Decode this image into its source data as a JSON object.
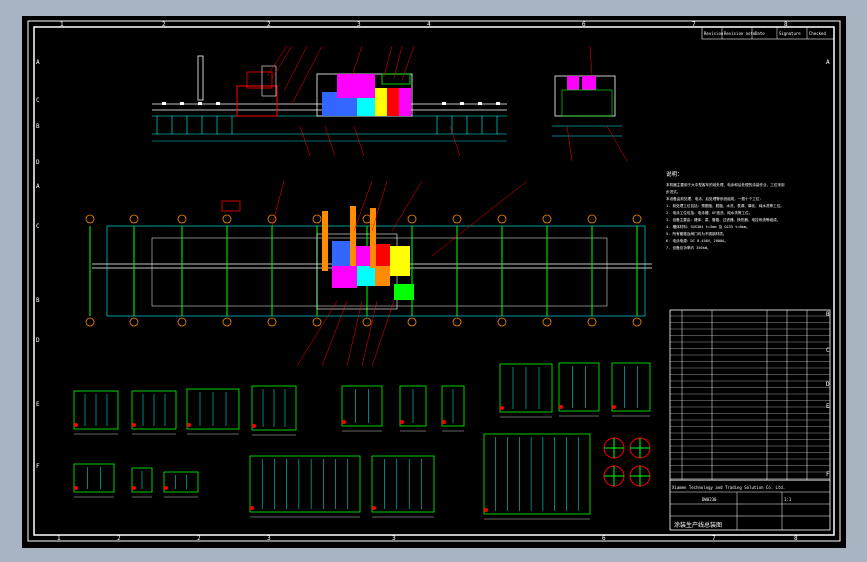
{
  "colors": {
    "background": "#a9b4c2",
    "sheet": "#000000",
    "frame": "#ffffff",
    "cyan": "#00ffff",
    "green": "#00ff00",
    "yellow": "#ffff00",
    "red": "#ff0000",
    "magenta": "#ff00ff",
    "orange": "#ff8c00",
    "blue": "#3366ff"
  },
  "top_border_numbers": [
    "1",
    "2",
    "3",
    "4",
    "5",
    "6",
    "7",
    "8"
  ],
  "bottom_border_numbers": [
    "1",
    "2",
    "3",
    "4",
    "5",
    "6",
    "7",
    "8"
  ],
  "left_border_letters": [
    "A",
    "C",
    "B",
    "D",
    "A",
    "C",
    "B",
    "D",
    "E",
    "F"
  ],
  "right_border_letters": [
    "A",
    "B",
    "C",
    "D",
    "B",
    "C",
    "D",
    "E",
    "F"
  ],
  "revision_table_headers": [
    "Revision",
    "Revision note",
    "Date",
    "Signature",
    "Checked"
  ],
  "notes": {
    "title": "说明：",
    "lines": [
      "本机器主要用于大中型客车的前处理、电泳和后处理的涂装作业，工位采用",
      "步进式。",
      "本设备由前处理、电泳、后处理等系统组成，一般十个工位：",
      "1. 前处理工位包括：预脱脂、脱脂、水洗、表调、磷化、纯水洗等工位。",
      "2. 电泳工位包括：电泳槽、UF液洗、纯水洗等工位。",
      "3. 设备主要由：槽体、泵、管路、过滤器、换热器、电控系统等组成。",
      "4. 槽体材料：SUS304 t=3mm 及 Q235 t=6mm。",
      "5. 所有管路及阀门均为不锈钢材质。",
      "6. 电泳电源：DC 0-450V，2000A。",
      "7. 设备总功率约 350kW。"
    ]
  },
  "title_block": {
    "company": "Xiamen Technology and Trading Solution Co. Ltd.",
    "drawing_no": "DW0230",
    "scale": "1:1",
    "title": "涂装生产线总装图"
  }
}
